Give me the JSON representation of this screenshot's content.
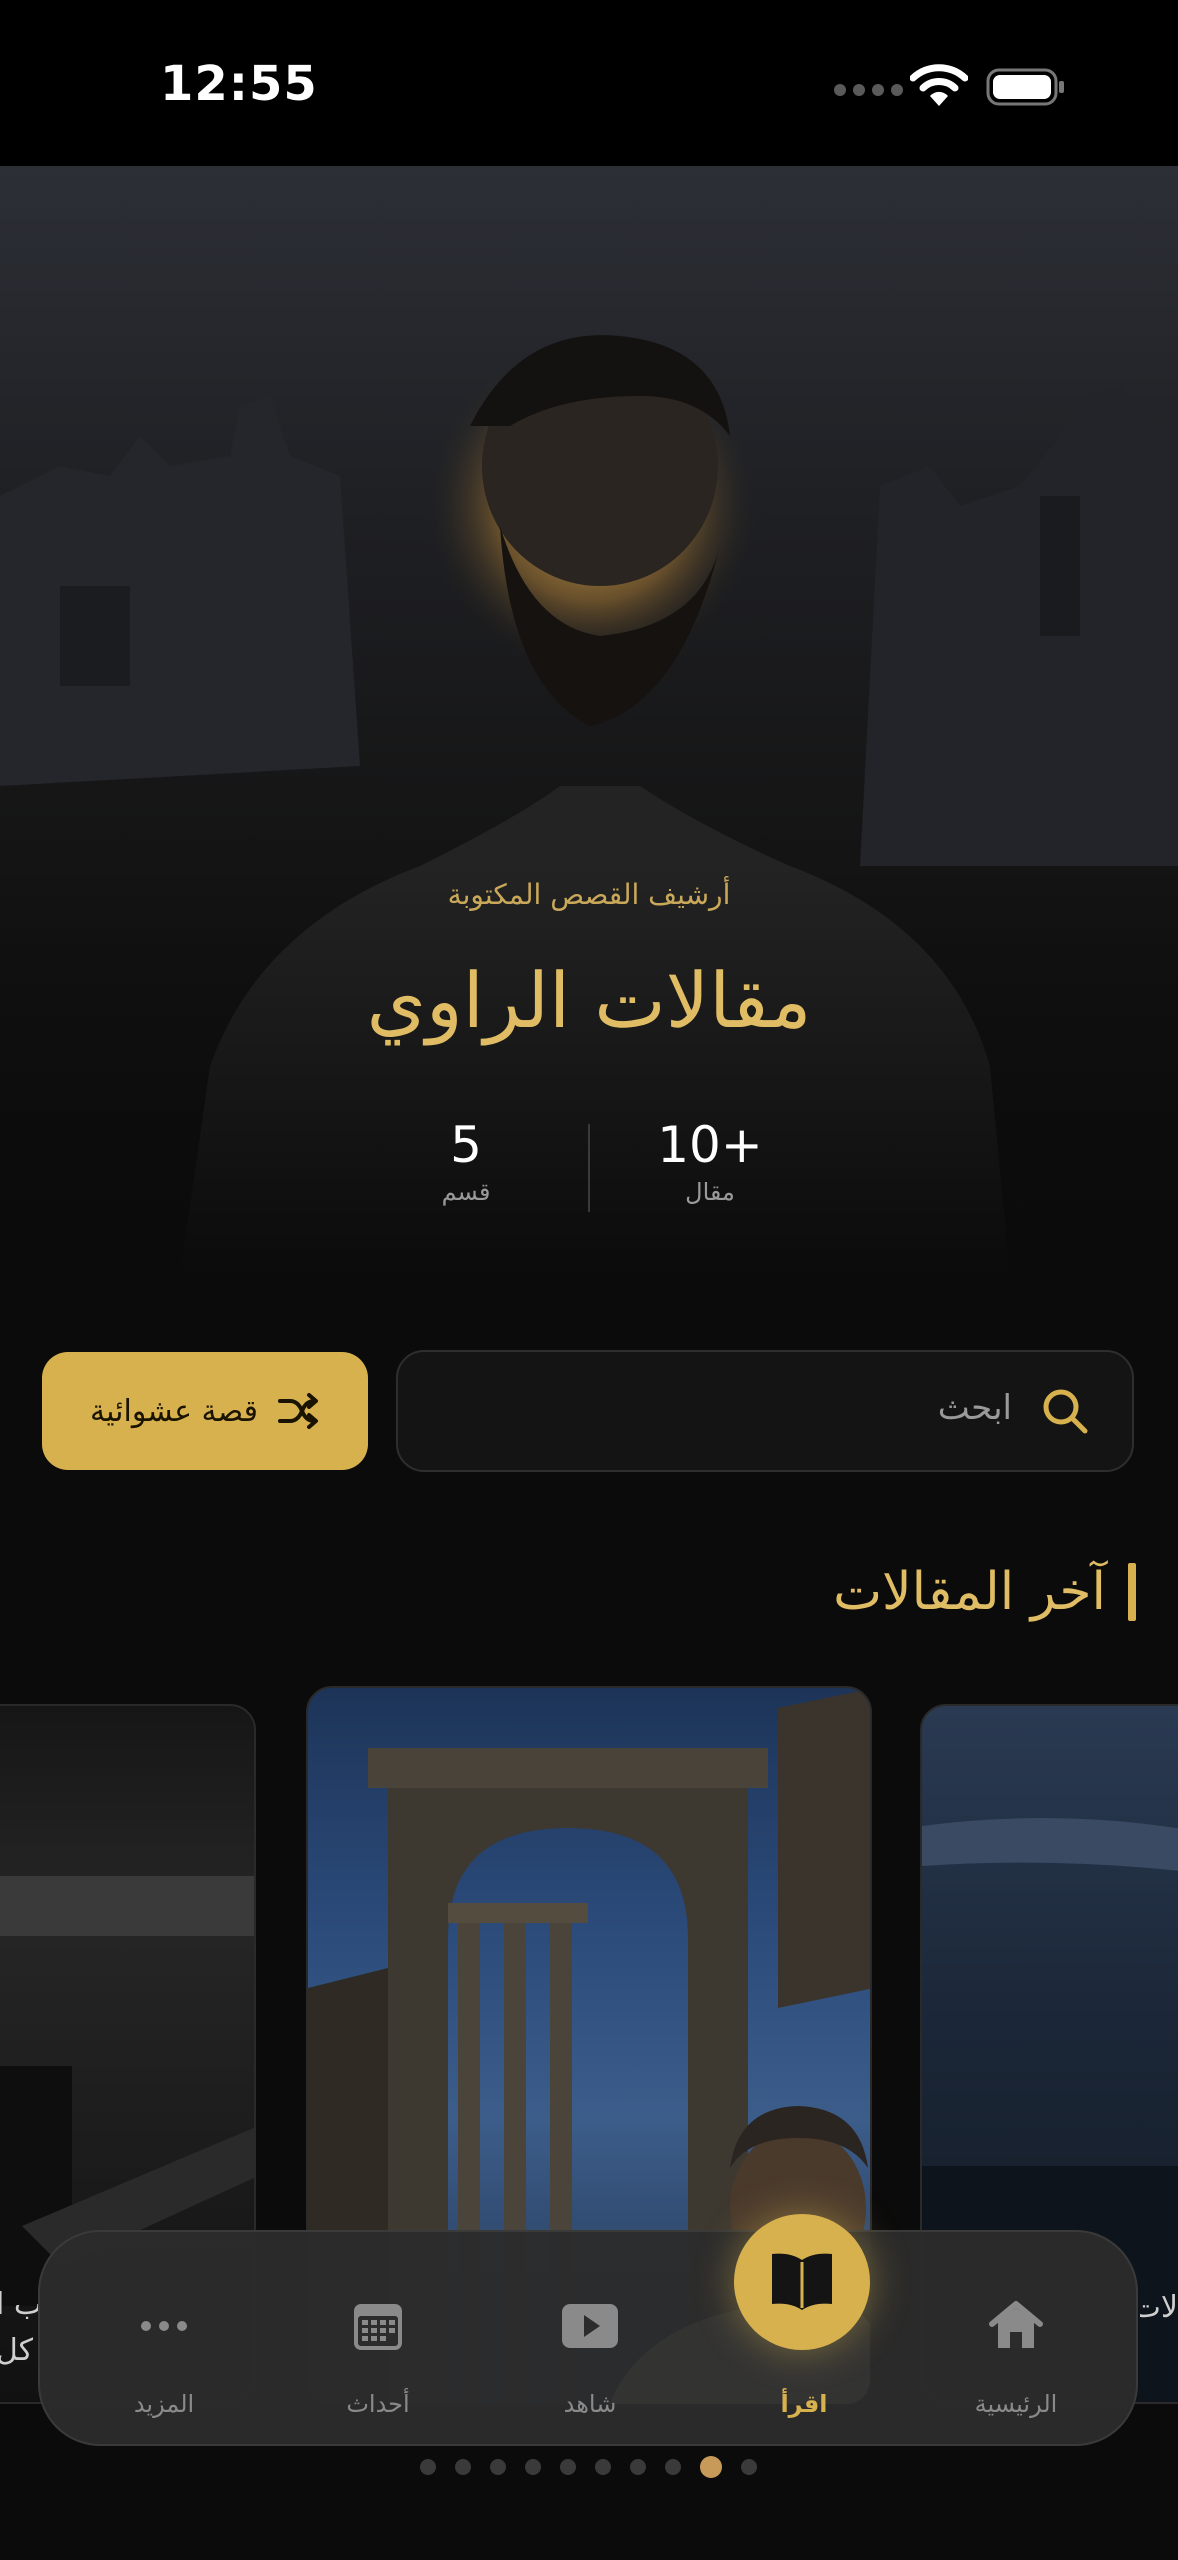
{
  "status_bar": {
    "time": "12:55"
  },
  "hero": {
    "subtitle": "أرشيف القصص المكتوبة",
    "title": "مقالات الراوي",
    "stats": [
      {
        "value": "10+",
        "label": "مقال"
      },
      {
        "value": "5",
        "label": "قسم"
      }
    ]
  },
  "search": {
    "placeholder": "ابحث"
  },
  "random_button": {
    "label": "قصة عشوائية",
    "icon": "shuffle-icon"
  },
  "section": {
    "title": "آخر المقالات"
  },
  "cards": {
    "left_text": "ب ا\nكل",
    "right_text": "لات"
  },
  "bottom_nav": {
    "items": [
      {
        "label": "الرئيسية",
        "icon": "home-icon"
      },
      {
        "label": "اقرأ",
        "icon": "book-icon",
        "active": true
      },
      {
        "label": "شاهد",
        "icon": "play-icon"
      },
      {
        "label": "أحداث",
        "icon": "calendar-icon"
      },
      {
        "label": "المزيد",
        "icon": "more-icon"
      }
    ]
  },
  "pager": {
    "count": 10,
    "active_index": 8
  },
  "colors": {
    "accent": "#d8b14f",
    "background": "#0b0b0b",
    "title_gold": "#e0bd64"
  }
}
